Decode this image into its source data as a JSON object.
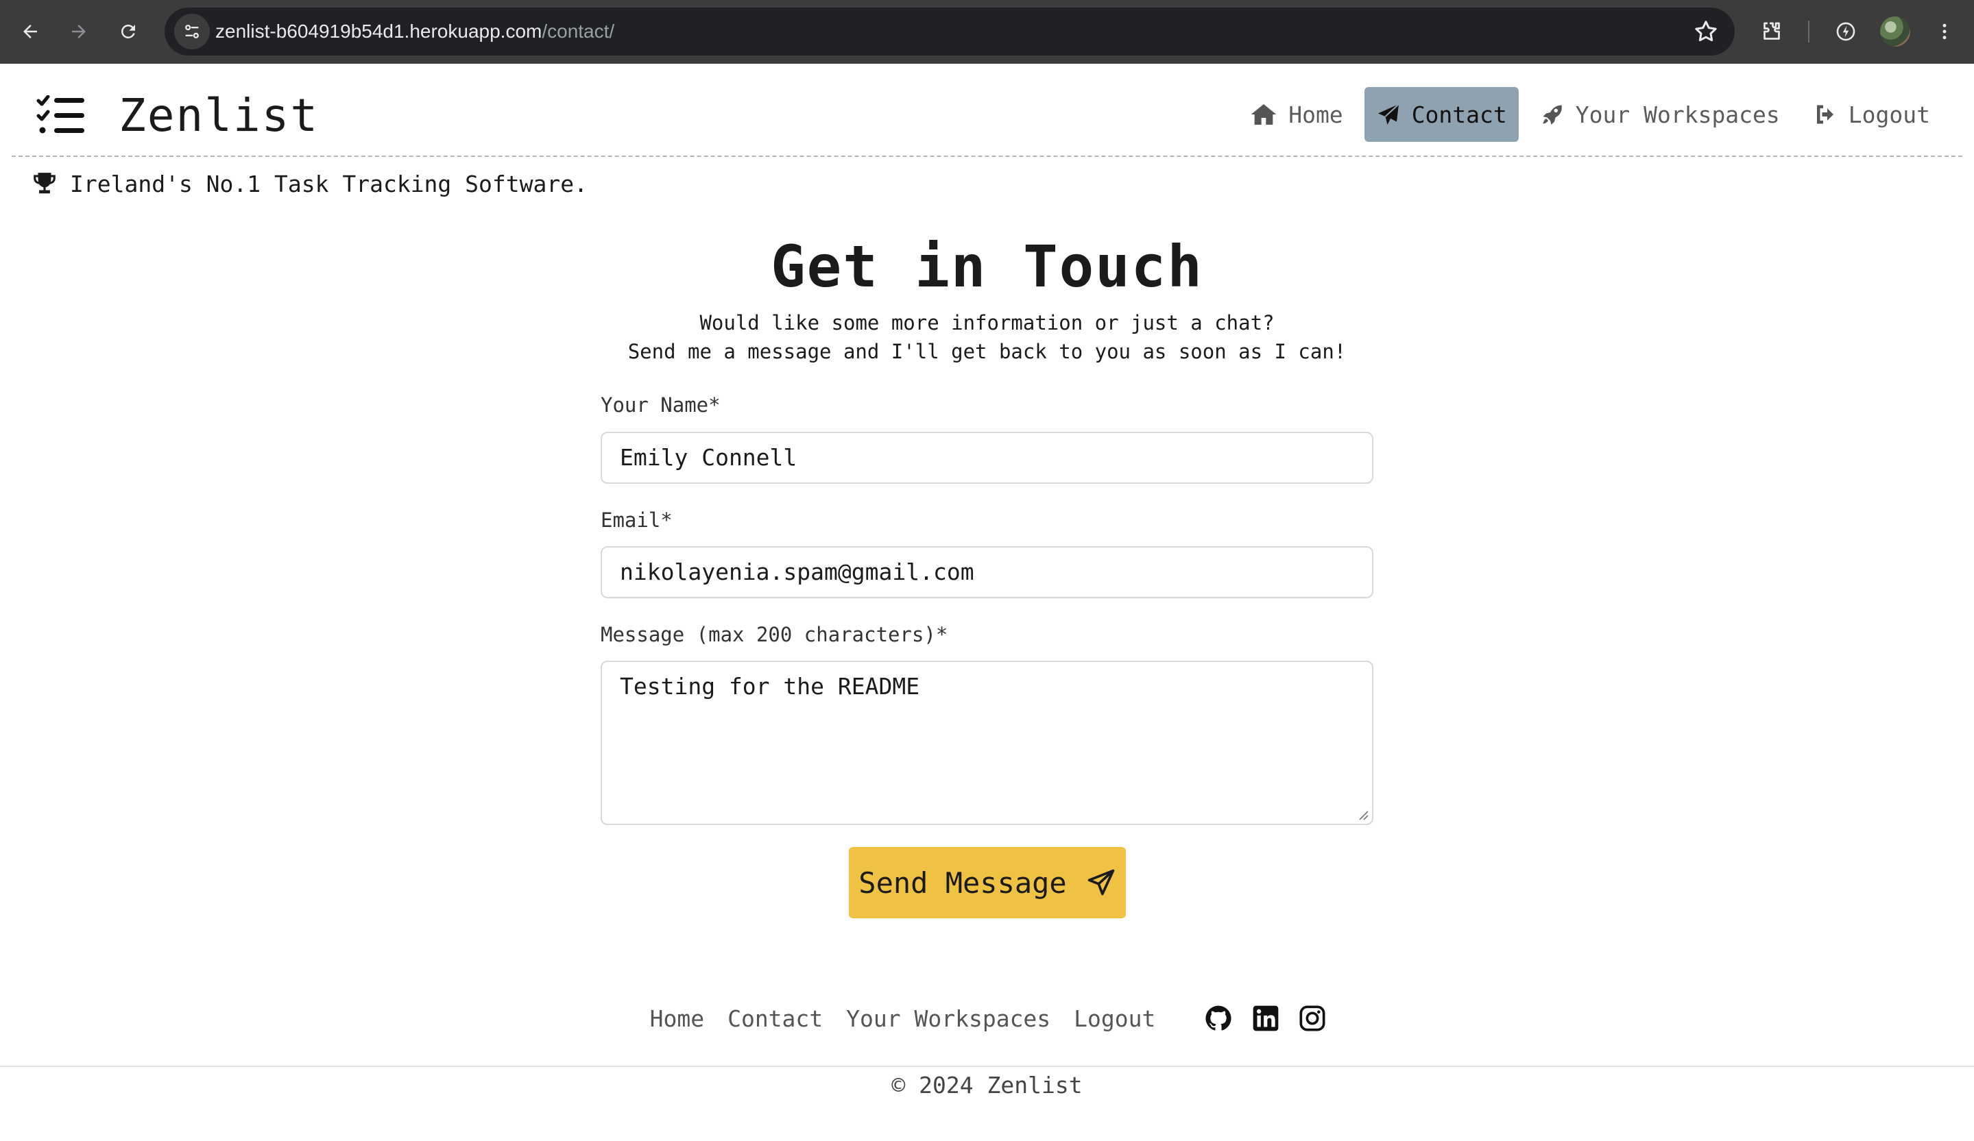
{
  "browser": {
    "url_host": "zenlist-b604919b54d1.herokuapp.com",
    "url_path": "/contact/",
    "icons": [
      "back-icon",
      "forward-icon",
      "reload-icon",
      "site-info-icon",
      "bookmark-star-icon",
      "extensions-icon",
      "performance-icon",
      "profile-avatar",
      "more-menu-icon"
    ]
  },
  "header": {
    "brand": "Zenlist",
    "nav": [
      {
        "label": "Home",
        "icon": "home-icon",
        "active": false
      },
      {
        "label": "Contact",
        "icon": "paper-plane-icon",
        "active": true
      },
      {
        "label": "Your Workspaces",
        "icon": "rocket-icon",
        "active": false
      },
      {
        "label": "Logout",
        "icon": "logout-icon",
        "active": false
      }
    ],
    "tagline": "Ireland's No.1 Task Tracking Software.",
    "tagline_icon": "trophy-icon",
    "active_color": "#8fa2b0"
  },
  "main": {
    "title": "Get in Touch",
    "intro_line1": "Would like some more information or just a chat?",
    "intro_line2": "Send me a message and I'll get back to you as soon as I can!",
    "form": {
      "name_label": "Your Name*",
      "name_value": "Emily Connell",
      "email_label": "Email*",
      "email_value": "nikolayenia.spam@gmail.com",
      "message_label": "Message (max 200 characters)*",
      "message_value": "Testing for the README",
      "submit_label": "Send Message",
      "submit_color": "#f0c243"
    }
  },
  "footer": {
    "links": [
      "Home",
      "Contact",
      "Your Workspaces",
      "Logout"
    ],
    "social_icons": [
      "github-icon",
      "linkedin-icon",
      "instagram-icon"
    ],
    "copyright": "© 2024 Zenlist"
  }
}
